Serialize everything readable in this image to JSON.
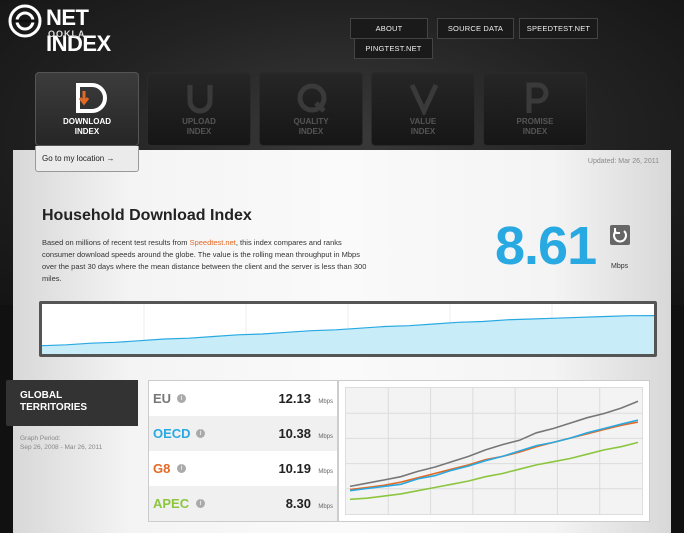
{
  "brand": {
    "title": "NET INDEX",
    "subtitle": "OOKLA"
  },
  "nav": {
    "about": "ABOUT",
    "source_data": "SOURCE DATA",
    "speedtest": "SPEEDTEST.NET",
    "pingtest": "PINGTEST.NET"
  },
  "tiles": [
    {
      "label": "DOWNLOAD\nINDEX",
      "letter": "D",
      "active": true
    },
    {
      "label": "UPLOAD\nINDEX",
      "letter": "U",
      "active": false
    },
    {
      "label": "QUALITY\nINDEX",
      "letter": "Q",
      "active": false
    },
    {
      "label": "VALUE\nINDEX",
      "letter": "V",
      "active": false
    },
    {
      "label": "PROMISE\nINDEX",
      "letter": "P",
      "active": false
    }
  ],
  "location_tab": "Go to my location →",
  "updated": "Updated: Mar 26, 2011",
  "heading": "Household Download Index",
  "description": {
    "before": "Based on millions of recent test results from ",
    "link": "Speedtest.net",
    "after": ", this index compares and ranks consumer download speeds around the globe. The value is the rolling mean throughput in Mbps over the past 30 days where the mean distance between the client and the server is less than 300 miles."
  },
  "headline_value": "8.61",
  "headline_unit": "Mbps",
  "colors": {
    "accent_blue": "#29a9e1",
    "orange": "#e26a26",
    "eu": "#777777",
    "oecd": "#29a9e1",
    "g8": "#e26a26",
    "apec": "#8cc63f"
  },
  "global": {
    "title_line1": "GLOBAL",
    "title_line2": "TERRITORIES",
    "period_label": "Graph Period:",
    "period_value": "Sep 26, 2008 - Mar 26, 2011"
  },
  "territories": [
    {
      "name": "EU",
      "value": "12.13",
      "unit": "Mbps",
      "color": "#777777"
    },
    {
      "name": "OECD",
      "value": "10.38",
      "unit": "Mbps",
      "color": "#29a9e1"
    },
    {
      "name": "G8",
      "value": "10.19",
      "unit": "Mbps",
      "color": "#e26a26"
    },
    {
      "name": "APEC",
      "value": "8.30",
      "unit": "Mbps",
      "color": "#8cc63f"
    }
  ],
  "chart_data": [
    {
      "type": "area",
      "series": [
        {
          "values": [
            5.0,
            5.1,
            5.3,
            5.4,
            5.6,
            5.8,
            5.9,
            6.1,
            6.3,
            6.4,
            6.6,
            6.8,
            6.9,
            7.1,
            7.3,
            7.4,
            7.6,
            7.8,
            7.9,
            8.1,
            8.2,
            8.3,
            8.4,
            8.5,
            8.6,
            8.61
          ]
        }
      ]
    },
    {
      "type": "line",
      "series": [
        {
          "name": "EU",
          "values": [
            4.2,
            4.5,
            4.8,
            5.1,
            5.6,
            6.0,
            6.5,
            7.0,
            7.6,
            8.1,
            8.5,
            9.2,
            9.6,
            10.1,
            10.6,
            11.0,
            11.5,
            12.13
          ],
          "color": "#777777"
        },
        {
          "name": "OECD",
          "values": [
            3.8,
            4.0,
            4.2,
            4.4,
            4.9,
            5.2,
            5.7,
            6.1,
            6.6,
            7.0,
            7.5,
            8.0,
            8.3,
            8.7,
            9.2,
            9.6,
            10.0,
            10.38
          ],
          "color": "#29a9e1"
        },
        {
          "name": "G8",
          "values": [
            3.9,
            4.1,
            4.3,
            4.6,
            5.0,
            5.4,
            5.8,
            6.2,
            6.7,
            7.0,
            7.4,
            7.9,
            8.3,
            8.7,
            9.1,
            9.5,
            9.9,
            10.19
          ],
          "color": "#e26a26"
        },
        {
          "name": "APEC",
          "values": [
            3.0,
            3.1,
            3.3,
            3.5,
            3.8,
            4.1,
            4.4,
            4.7,
            5.1,
            5.4,
            5.8,
            6.2,
            6.5,
            6.8,
            7.2,
            7.6,
            7.9,
            8.3
          ],
          "color": "#8cc63f"
        }
      ],
      "ylim": [
        2,
        13
      ],
      "grid": true
    }
  ]
}
